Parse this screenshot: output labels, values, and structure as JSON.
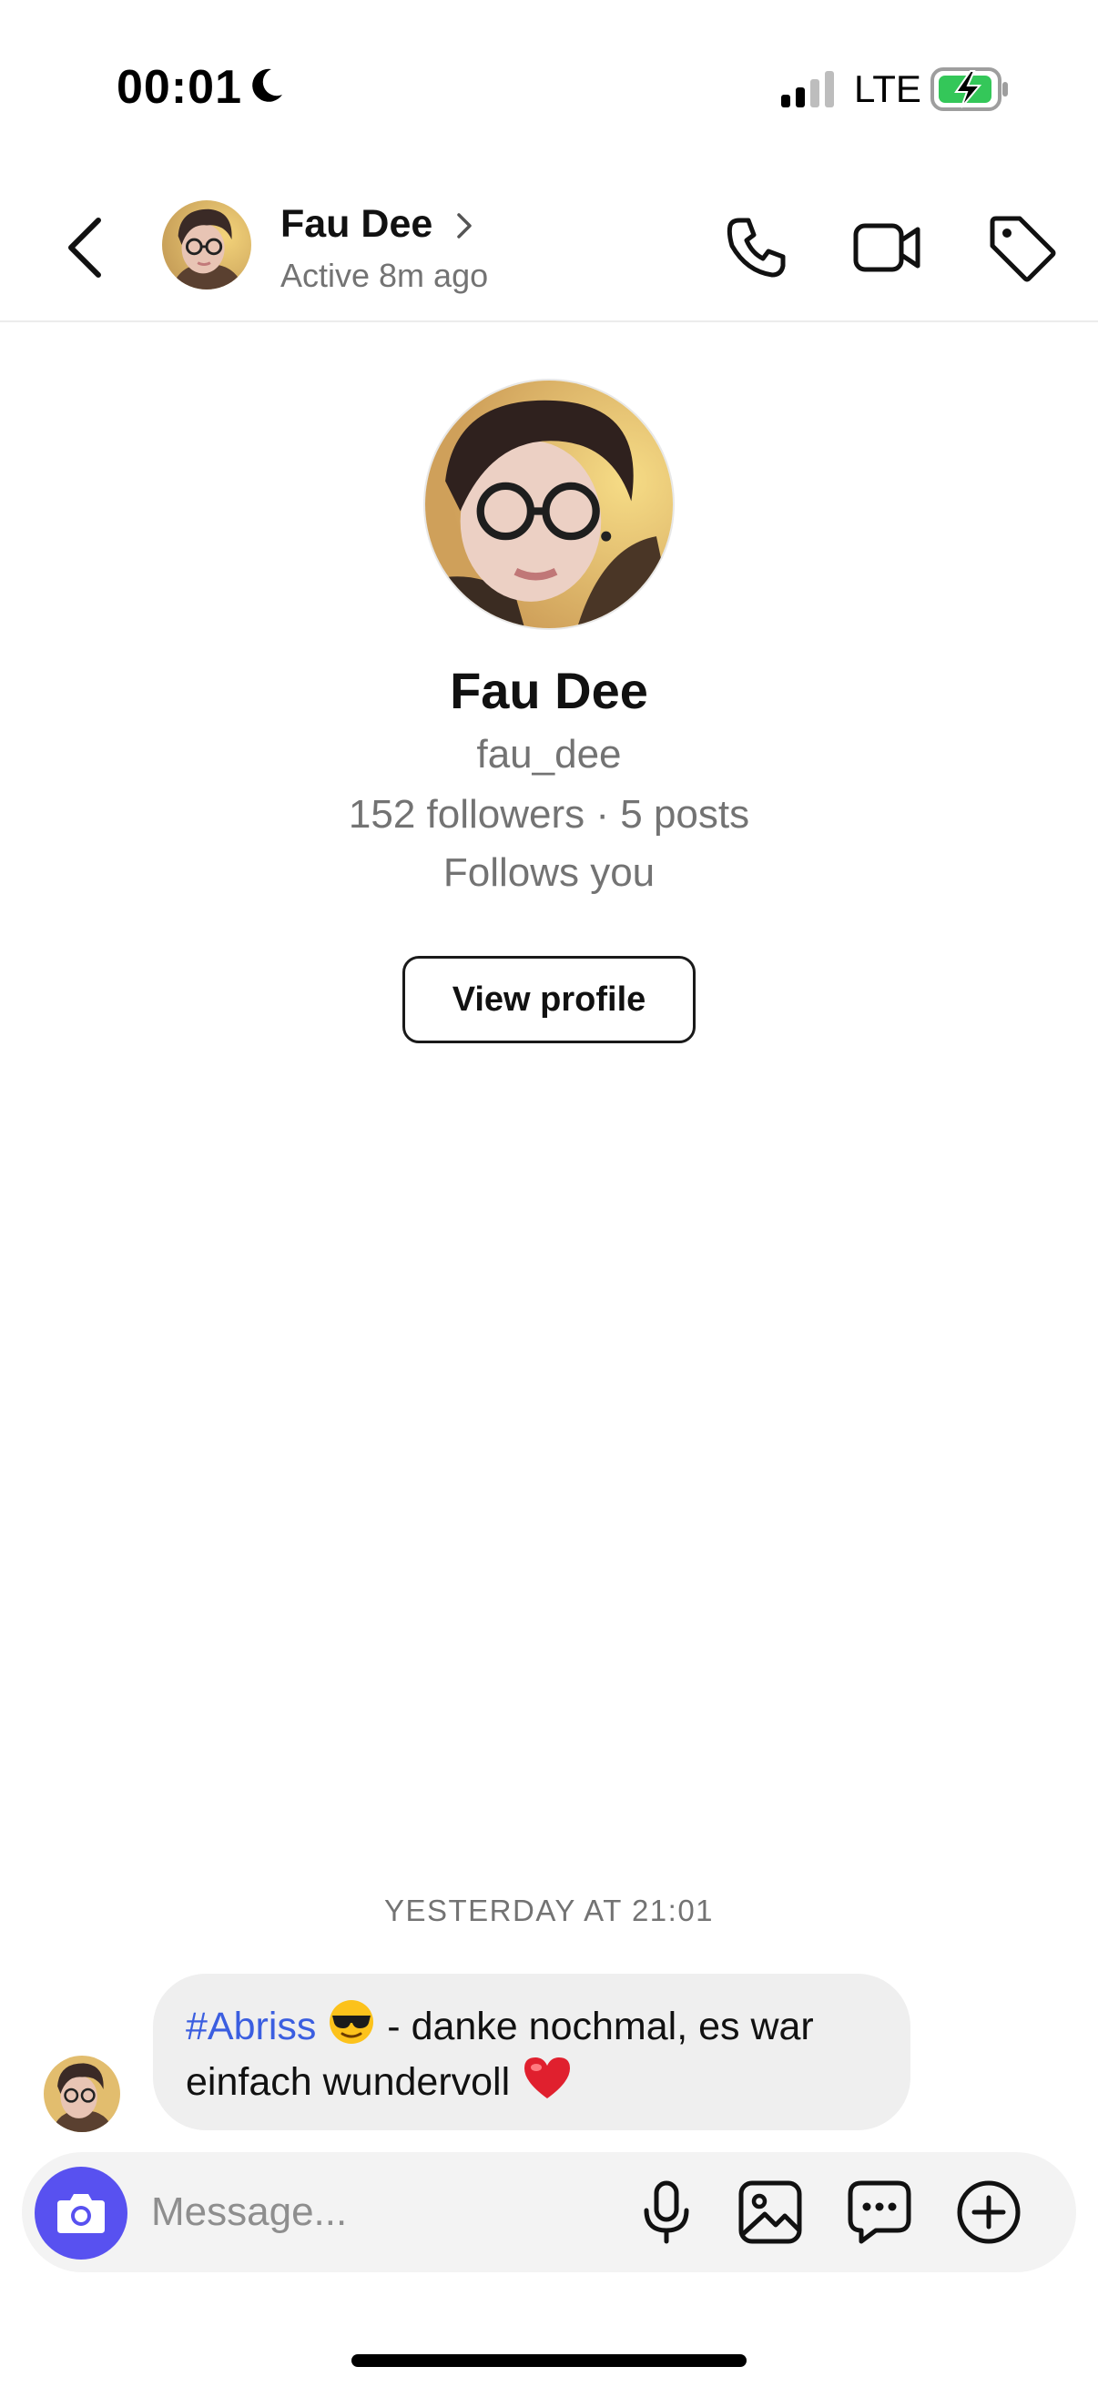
{
  "status_bar": {
    "time": "00:01",
    "network": "LTE",
    "icons": [
      "moon-icon",
      "signal-icon",
      "battery-charging-icon"
    ]
  },
  "header": {
    "name": "Fau Dee",
    "activity": "Active 8m ago",
    "icons": [
      "back-chevron-icon",
      "chevron-right-icon",
      "phone-icon",
      "video-camera-icon",
      "tag-icon"
    ]
  },
  "profile": {
    "name": "Fau Dee",
    "username": "fau_dee",
    "stats": "152 followers · 5 posts",
    "follows": "Follows you",
    "view_profile_label": "View profile"
  },
  "conversation": {
    "timestamp": "YESTERDAY AT 21:01",
    "messages": [
      {
        "hashtag": "#Abriss",
        "text_after_emoji": " - danke nochmal, es war",
        "line2": "einfach wundervoll",
        "emojis": [
          "sunglasses-emoji",
          "red-heart-emoji"
        ]
      }
    ]
  },
  "composer": {
    "placeholder": "Message...",
    "icons": [
      "camera-icon",
      "microphone-icon",
      "gallery-icon",
      "sticker-chat-icon",
      "plus-circle-icon"
    ]
  },
  "colors": {
    "accent": "#5851f0",
    "hashtag": "#3b5ee0",
    "bubble": "#efefef",
    "secondary_text": "#737373",
    "battery_green": "#34c759",
    "heart": "#e0202e"
  }
}
